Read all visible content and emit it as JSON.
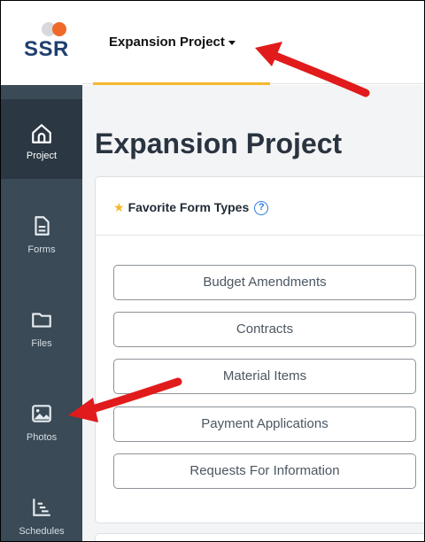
{
  "logo": {
    "text": "SSR",
    "colors": {
      "grey": "#d7d9dc",
      "orange": "#ef6a2a",
      "text": "#1f3f6e"
    }
  },
  "header": {
    "project_selector": "Expansion Project",
    "accent": "#f5b82e"
  },
  "sidebar": {
    "items": [
      {
        "label": "Project",
        "icon": "home-icon",
        "active": true
      },
      {
        "label": "Forms",
        "icon": "document-icon",
        "active": false
      },
      {
        "label": "Files",
        "icon": "folder-icon",
        "active": false
      },
      {
        "label": "Photos",
        "icon": "image-icon",
        "active": false
      },
      {
        "label": "Schedules",
        "icon": "schedule-icon",
        "active": false
      }
    ]
  },
  "main": {
    "title": "Expansion Project",
    "favorites": {
      "title": "Favorite Form Types",
      "help": "?",
      "form_types": [
        "Budget Amendments",
        "Contracts",
        "Material Items",
        "Payment Applications",
        "Requests For Information"
      ]
    }
  },
  "annotation_color": "#e11b1b"
}
